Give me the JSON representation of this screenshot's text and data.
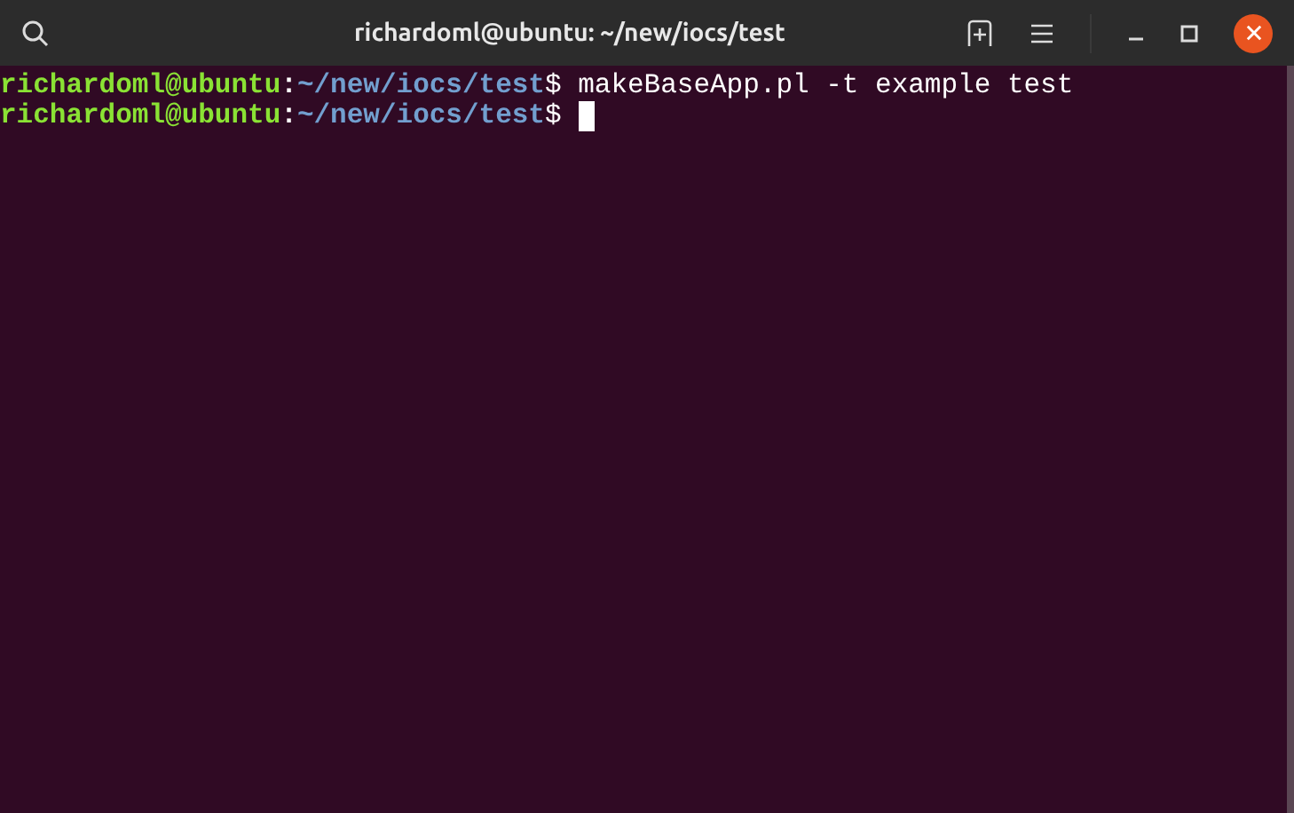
{
  "window": {
    "title": "richardoml@ubuntu: ~/new/iocs/test"
  },
  "terminal": {
    "lines": [
      {
        "user_host": "richardoml@ubuntu",
        "separator": ":",
        "path": "~/new/iocs/test",
        "prompt": "$",
        "command": " makeBaseApp.pl -t example test",
        "cursor": false
      },
      {
        "user_host": "richardoml@ubuntu",
        "separator": ":",
        "path": "~/new/iocs/test",
        "prompt": "$",
        "cursor": true
      }
    ]
  }
}
